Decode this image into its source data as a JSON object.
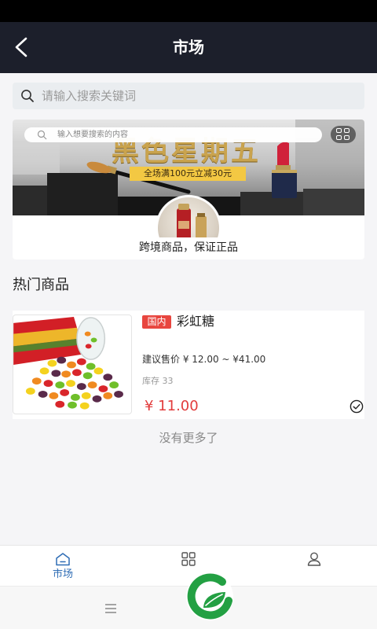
{
  "header": {
    "title": "市场",
    "back_icon": "chevron-left-icon"
  },
  "search": {
    "placeholder": "请输入搜索关键词",
    "value": "",
    "icon": "search-icon"
  },
  "banner": {
    "search_placeholder": "输入想要搜索的内容",
    "headline": "黑色星期五",
    "promo": "全场满100元立减30元",
    "caption": "跨境商品，保证正品",
    "grid_icon": "grid-icon"
  },
  "section": {
    "title": "热门商品"
  },
  "products": [
    {
      "tag": "国内",
      "name": "彩虹糖",
      "suggested_price": "建议售价 ¥ 12.00 ~ ¥41.00",
      "stock": "库存 33",
      "price": "¥ 11.00",
      "status_icon": "check-circle-icon"
    }
  ],
  "list_end": "没有更多了",
  "tabs": [
    {
      "label": "市场",
      "icon": "home-icon",
      "active": true
    },
    {
      "icon": "grid-icon",
      "active": false
    },
    {
      "icon": "user-icon",
      "active": false
    }
  ],
  "system_nav": {
    "menu_icon": "menu-icon"
  },
  "logo": {
    "icon": "green-leaf-logo"
  },
  "colors": {
    "header_bg": "#1c1f2b",
    "accent": "#2f6db5",
    "price": "#e23c3c",
    "tag_bg": "#e8463f",
    "logo_green": "#23a043",
    "page_bg": "#f5f5f7"
  }
}
